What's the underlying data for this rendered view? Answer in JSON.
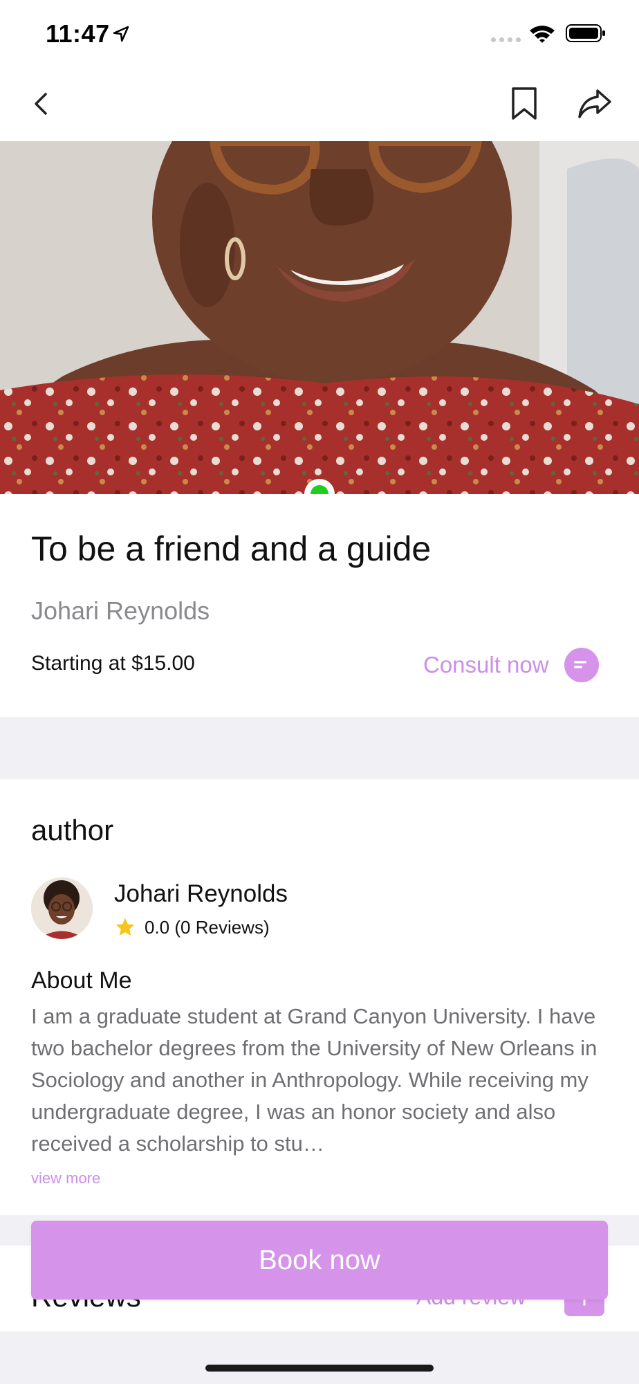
{
  "status_bar": {
    "time": "11:47"
  },
  "nav": {
    "back_icon": "chevron-left-icon",
    "bookmark_icon": "bookmark-icon",
    "share_icon": "share-icon"
  },
  "hero": {
    "online": true,
    "online_color": "#1fcf1f"
  },
  "service": {
    "title": "To be a friend and a guide",
    "provider": "Johari Reynolds",
    "price": "Starting at $15.00",
    "consult_label": "Consult now"
  },
  "author": {
    "section_title": "author",
    "name": "Johari Reynolds",
    "rating": "0.0 (0 Reviews)",
    "about_title": "About Me",
    "about_text": "I am a graduate student at Grand Canyon University. I have two bachelor degrees from the University of New Orleans in Sociology and another in Anthropology. While receiving my undergraduate degree, I was an honor society and also received a scholarship to stu…",
    "view_more": "view more"
  },
  "reviews": {
    "section_title": "Reviews",
    "add_label": "Add review",
    "add_button": "+"
  },
  "cta": {
    "book_label": "Book now"
  },
  "colors": {
    "accent": "#d693ea",
    "accent_text": "#cc8ee6",
    "star": "#f7c51c",
    "divider": "#f1f1f5"
  }
}
